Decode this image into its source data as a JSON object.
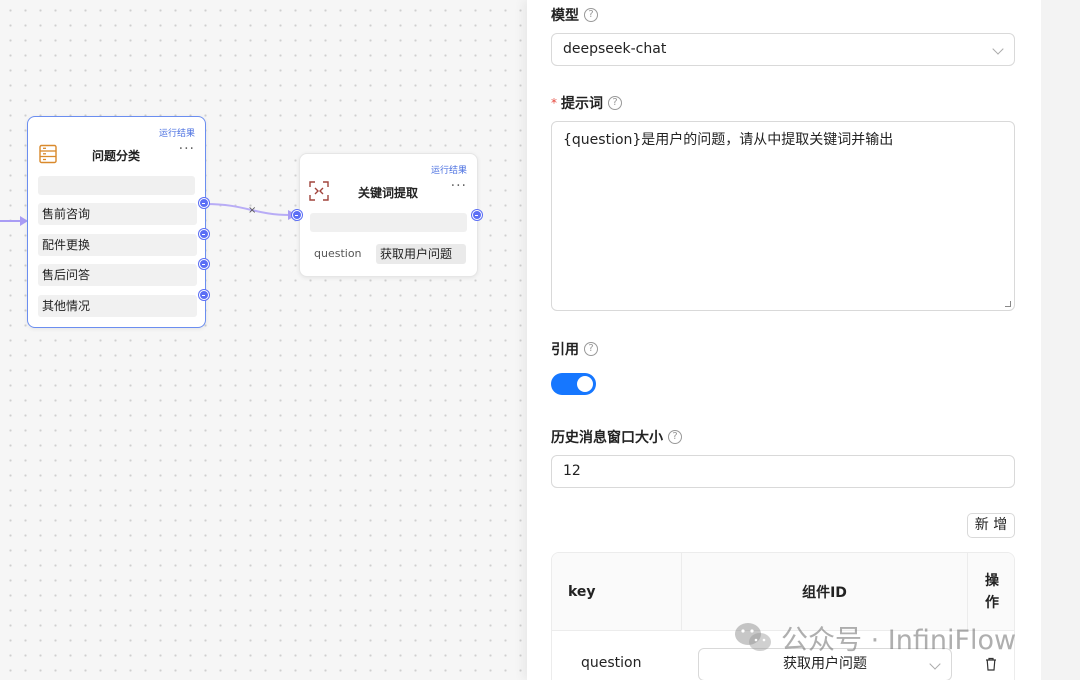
{
  "canvas": {
    "classify_node": {
      "run_result": "运行结果",
      "title": "问题分类",
      "more": "···",
      "categories": [
        "售前咨询",
        "配件更换",
        "售后问答",
        "其他情况"
      ]
    },
    "keyword_node": {
      "run_result": "运行结果",
      "title": "关键词提取",
      "more": "···",
      "param_key": "question",
      "param_value": "获取用户问题"
    },
    "edge_label": "×"
  },
  "panel": {
    "model": {
      "label": "模型",
      "help": "?",
      "value": "deepseek-chat"
    },
    "prompt": {
      "required": "*",
      "label": "提示词",
      "help": "?",
      "value": "{question}是用户的问题，请从中提取关键词并输出"
    },
    "citation": {
      "label": "引用",
      "help": "?",
      "enabled": true
    },
    "history_window": {
      "label": "历史消息窗口大小",
      "help": "?",
      "value": "12"
    },
    "add_button": "新 增",
    "table": {
      "headers": {
        "key": "key",
        "component_id": "组件ID",
        "action": "操作"
      },
      "rows": [
        {
          "key": "question",
          "component_id": "获取用户问题"
        }
      ]
    }
  },
  "watermark": {
    "text": "公众号 · InfiniFlow"
  },
  "colors": {
    "accent": "#1677ff",
    "handle": "#5b6ef5",
    "node_border": "#6b8ef0",
    "required": "#e5483d"
  }
}
